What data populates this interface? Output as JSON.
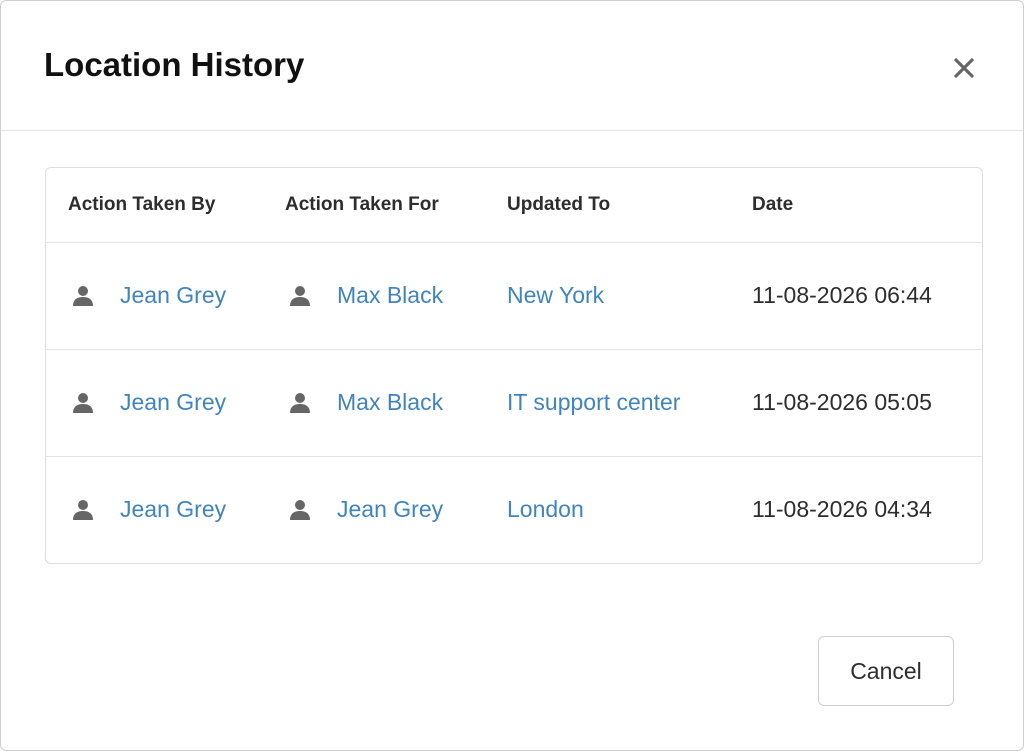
{
  "modal": {
    "title": "Location History",
    "cancel_label": "Cancel"
  },
  "table": {
    "headers": [
      "Action Taken By",
      "Action Taken For",
      "Updated To",
      "Date"
    ],
    "rows": [
      {
        "taken_by": "Jean Grey",
        "taken_for": "Max Black",
        "updated_to": "New York",
        "date": "11-08-2026 06:44"
      },
      {
        "taken_by": "Jean Grey",
        "taken_for": "Max Black",
        "updated_to": "IT support center",
        "date": "11-08-2026 05:05"
      },
      {
        "taken_by": "Jean Grey",
        "taken_for": "Jean Grey",
        "updated_to": "London",
        "date": "11-08-2026 04:34"
      }
    ]
  },
  "icons": {
    "close": "close-icon",
    "user": "person-icon"
  },
  "colors": {
    "link": "#3f84bf",
    "icon": "#666666",
    "text": "#2d2d2d",
    "border": "#dedede"
  }
}
